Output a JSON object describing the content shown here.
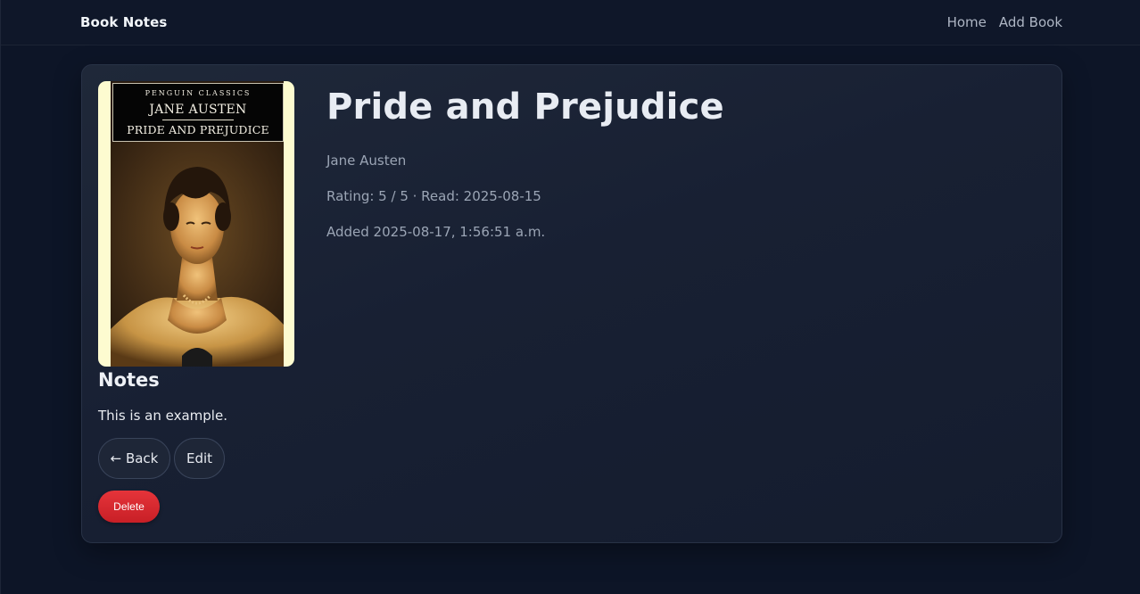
{
  "header": {
    "brand": "Book Notes",
    "nav": [
      {
        "label": "Home"
      },
      {
        "label": "Add Book"
      }
    ]
  },
  "book": {
    "title": "Pride and Prejudice",
    "author": "Jane Austen",
    "rating_line": "Rating: 5 / 5 · Read: 2025-08-15",
    "added_line": "Added 2025-08-17, 1:56:51 a.m.",
    "cover": {
      "series": "PENGUIN CLASSICS",
      "author": "JANE AUSTEN",
      "title": "PRIDE AND PREJUDICE"
    }
  },
  "notes": {
    "heading": "Notes",
    "text": "This is an example."
  },
  "actions": {
    "back_label": "← Back",
    "edit_label": "Edit",
    "delete_label": "Delete"
  },
  "colors": {
    "background": "#0d1527",
    "card": "#1b2335",
    "delete": "#d9282f",
    "cover_border": "#fdfbd0"
  }
}
